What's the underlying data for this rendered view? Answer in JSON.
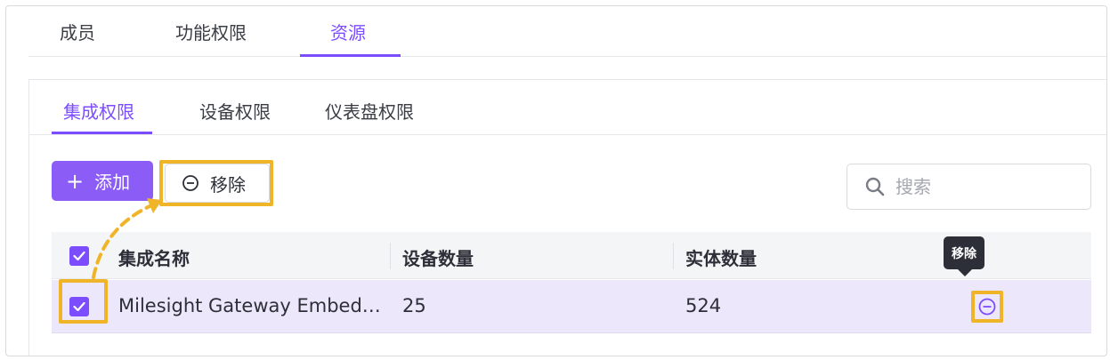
{
  "top_tabs": [
    {
      "label": "成员"
    },
    {
      "label": "功能权限"
    },
    {
      "label": "资源"
    }
  ],
  "sub_tabs": [
    {
      "label": "集成权限"
    },
    {
      "label": "设备权限"
    },
    {
      "label": "仪表盘权限"
    }
  ],
  "toolbar": {
    "add_label": "添加",
    "remove_label": "移除"
  },
  "search": {
    "placeholder": "搜索"
  },
  "table": {
    "headers": [
      "集成名称",
      "设备数量",
      "实体数量"
    ],
    "rows": [
      {
        "name": "Milesight Gateway Embed…",
        "devices": "25",
        "entities": "524",
        "selected": true
      }
    ]
  },
  "tooltip": {
    "text": "移除"
  },
  "colors": {
    "accent": "#7c4dff",
    "highlight": "#f0b429",
    "row_selected_bg": "#ede7fb"
  }
}
